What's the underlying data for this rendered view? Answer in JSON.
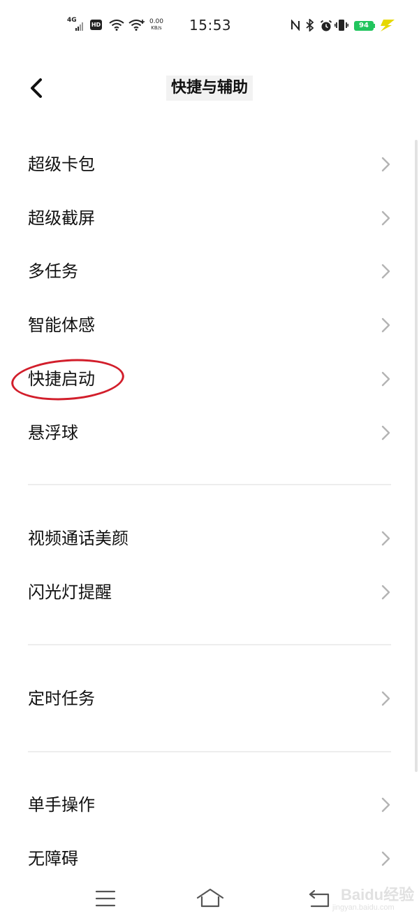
{
  "status_bar": {
    "network": "4G",
    "hd": "HD",
    "speed_value": "0.00",
    "speed_unit": "KB/s",
    "time": "15:53",
    "battery": "94",
    "battery_color": "#22c55e",
    "charging_color": "#e6d800",
    "icons": [
      "signal-icon",
      "hd-icon",
      "wifi-icon",
      "wifi-plus-icon",
      "nfc-icon",
      "bluetooth-icon",
      "alarm-icon",
      "vibrate-icon",
      "battery-icon",
      "charging-icon"
    ]
  },
  "header": {
    "title": "快捷与辅助",
    "back_icon": "back-chevron-icon"
  },
  "sections": [
    {
      "items": [
        {
          "label": "超级卡包"
        },
        {
          "label": "超级截屏"
        },
        {
          "label": "多任务"
        },
        {
          "label": "智能体感"
        },
        {
          "label": "快捷启动",
          "highlighted": true
        },
        {
          "label": "悬浮球"
        }
      ]
    },
    {
      "items": [
        {
          "label": "视频通话美颜"
        },
        {
          "label": "闪光灯提醒"
        }
      ]
    },
    {
      "items": [
        {
          "label": "定时任务"
        }
      ]
    },
    {
      "items": [
        {
          "label": "单手操作"
        },
        {
          "label": "无障碍"
        }
      ]
    }
  ],
  "annotation": {
    "color": "#d21e2b",
    "target": "快捷启动"
  },
  "nav_bar": {
    "icons": [
      "menu-icon",
      "home-icon",
      "back-icon"
    ]
  },
  "watermark": {
    "main": "Baidu经验",
    "sub": "jingyan.baidu.com"
  }
}
